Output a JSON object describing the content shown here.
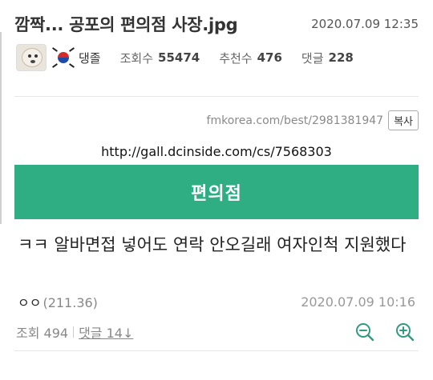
{
  "post": {
    "title": "깜짝... 공포의 편의점 사장.jpg",
    "date": "2020.07.09 12:35"
  },
  "author": {
    "nickname": "댕졸",
    "avatar_icon": "dog-avatar",
    "flag_icon": "korea-flag-icon"
  },
  "stats": {
    "views_label": "조회수",
    "views_value": "55474",
    "recommend_label": "추천수",
    "recommend_value": "476",
    "comments_label": "댓글",
    "comments_value": "228"
  },
  "source": {
    "url": "fmkorea.com/best/2981381947",
    "copy_label": "복사"
  },
  "content": {
    "link": "http://gall.dcinside.com/cs/7568303",
    "banner": "편의점",
    "banner_color": "#2fae84",
    "text": "ㅋㅋ 알바면접 넣어도 연락 안오길래 여자인척 지원했다"
  },
  "comment": {
    "author": "ㅇㅇ",
    "score": "(211.36)",
    "date": "2020.07.09 10:16",
    "views": "조회 494",
    "reply": "댓글 14↓"
  },
  "colors": {
    "accent": "#2fae84",
    "zoom_icon": "#2f9c7e"
  }
}
